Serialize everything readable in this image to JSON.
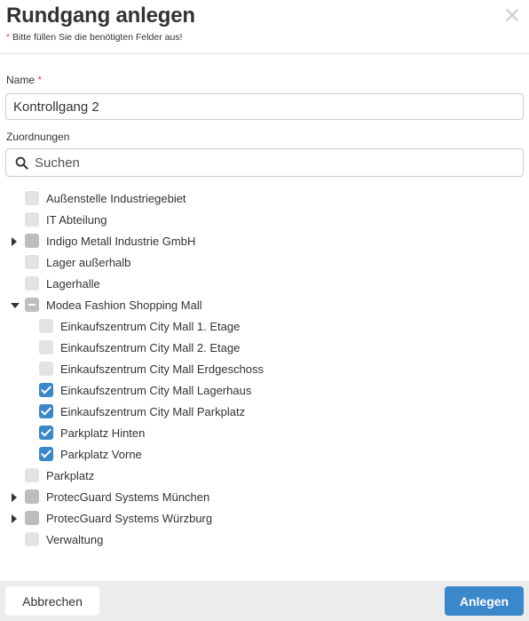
{
  "dialog": {
    "title": "Rundgang anlegen",
    "required_star": "*",
    "required_note": "Bitte füllen Sie die benötigten Felder aus!"
  },
  "name_field": {
    "label": "Name",
    "required_star": "*",
    "value": "Kontrollgang 2"
  },
  "assignments": {
    "label": "Zuordnungen",
    "search_placeholder": "Suchen"
  },
  "tree": [
    {
      "label": "Außenstelle Industriegebiet",
      "level": 0,
      "expander": "none",
      "state": "unchecked"
    },
    {
      "label": "IT Abteilung",
      "level": 0,
      "expander": "none",
      "state": "unchecked"
    },
    {
      "label": "Indigo Metall Industrie GmbH",
      "level": 0,
      "expander": "collapsed",
      "state": "unchecked-gray"
    },
    {
      "label": "Lager außerhalb",
      "level": 0,
      "expander": "none",
      "state": "unchecked"
    },
    {
      "label": "Lagerhalle",
      "level": 0,
      "expander": "none",
      "state": "unchecked"
    },
    {
      "label": "Modea Fashion Shopping Mall",
      "level": 0,
      "expander": "expanded",
      "state": "partial"
    },
    {
      "label": "Einkaufszentrum City Mall 1. Etage",
      "level": 1,
      "expander": "none",
      "state": "unchecked"
    },
    {
      "label": "Einkaufszentrum City Mall 2. Etage",
      "level": 1,
      "expander": "none",
      "state": "unchecked"
    },
    {
      "label": "Einkaufszentrum City Mall Erdgeschoss",
      "level": 1,
      "expander": "none",
      "state": "unchecked"
    },
    {
      "label": "Einkaufszentrum City Mall Lagerhaus",
      "level": 1,
      "expander": "none",
      "state": "checked"
    },
    {
      "label": "Einkaufszentrum City Mall Parkplatz",
      "level": 1,
      "expander": "none",
      "state": "checked"
    },
    {
      "label": "Parkplatz Hinten",
      "level": 1,
      "expander": "none",
      "state": "checked"
    },
    {
      "label": "Parkplatz Vorne",
      "level": 1,
      "expander": "none",
      "state": "checked"
    },
    {
      "label": "Parkplatz",
      "level": 0,
      "expander": "none",
      "state": "unchecked"
    },
    {
      "label": "ProtecGuard Systems München",
      "level": 0,
      "expander": "collapsed",
      "state": "unchecked-gray"
    },
    {
      "label": "ProtecGuard Systems Würzburg",
      "level": 0,
      "expander": "collapsed",
      "state": "unchecked-gray"
    },
    {
      "label": "Verwaltung",
      "level": 0,
      "expander": "none",
      "state": "unchecked"
    }
  ],
  "footer": {
    "cancel_label": "Abbrechen",
    "submit_label": "Anlegen"
  },
  "colors": {
    "accent": "#3a87c9",
    "required": "#d9534f",
    "footer_bg": "#ececec"
  }
}
